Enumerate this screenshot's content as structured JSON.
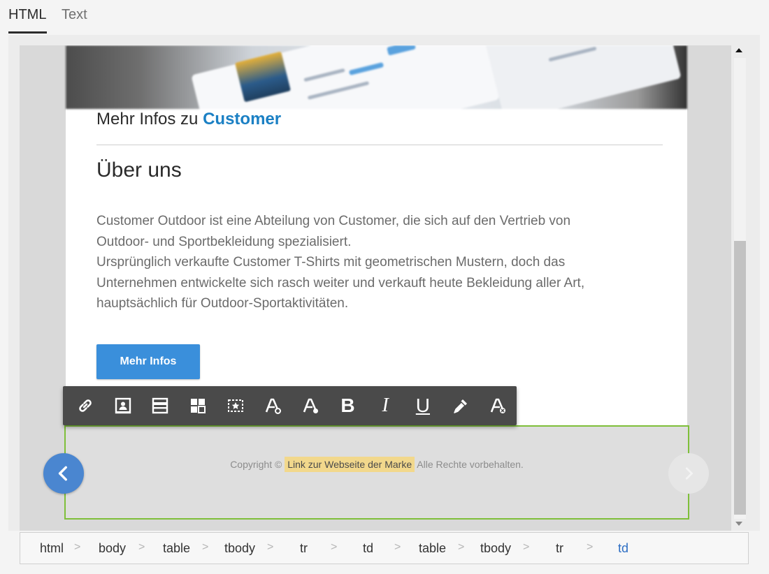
{
  "tabs": [
    {
      "label": "HTML",
      "active": true
    },
    {
      "label": "Text",
      "active": false
    }
  ],
  "email": {
    "heading_prefix": "Mehr Infos zu",
    "heading_brand": "Customer",
    "about_title": "Über uns",
    "paragraph_lines": [
      "Customer Outdoor ist eine Abteilung von Customer, die sich auf den Vertrieb von",
      "Outdoor- und Sportbekleidung spezialisiert.",
      "Ursprünglich verkaufte Customer T-Shirts mit geometrischen Mustern, doch das",
      "Unternehmen entwickelte sich rasch weiter und verkauft heute Bekleidung aller Art,",
      "hauptsächlich für Outdoor-Sportaktivitäten."
    ],
    "cta_label": "Mehr Infos"
  },
  "toolbar": {
    "items": [
      {
        "name": "link-icon"
      },
      {
        "name": "personalization-icon"
      },
      {
        "name": "content-block-icon"
      },
      {
        "name": "layout-icon"
      },
      {
        "name": "dynamic-content-icon"
      },
      {
        "name": "font-style-icon"
      },
      {
        "name": "font-size-icon"
      },
      {
        "name": "bold-icon",
        "text": "B"
      },
      {
        "name": "italic-icon",
        "text": "I"
      },
      {
        "name": "underline-icon",
        "text": "U"
      },
      {
        "name": "color-picker-icon"
      },
      {
        "name": "clear-format-icon"
      }
    ]
  },
  "footer": {
    "prefix": "Copyright ©",
    "link_text": "Link zur Webseite der Marke",
    "suffix": "Alle Rechte vorbehalten."
  },
  "breadcrumb": [
    "html",
    "body",
    "table",
    "tbody",
    "tr",
    "td",
    "table",
    "tbody",
    "tr",
    "td"
  ],
  "colors": {
    "brand_blue": "#1b80c4",
    "button_blue": "#3a8fdb",
    "selection_green": "#7fbf3a",
    "link_highlight": "#f2d88c",
    "current_crumb": "#2e6fc4"
  }
}
